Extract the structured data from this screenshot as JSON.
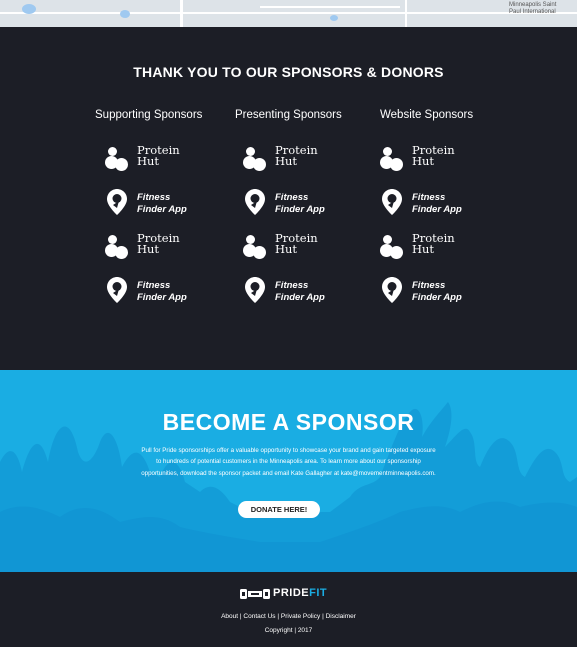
{
  "map": {
    "city_label": "Minneapolis Saint Paul International"
  },
  "sponsors": {
    "title": "THANK YOU TO OUR SPONSORS & DONORS",
    "columns": [
      {
        "heading": "Supporting Sponsors",
        "logos": [
          {
            "type": "protein-hut",
            "line1": "Protein",
            "line2": "Hut"
          },
          {
            "type": "fitness-finder",
            "line1": "Fitness",
            "line2": "Finder App"
          },
          {
            "type": "protein-hut",
            "line1": "Protein",
            "line2": "Hut"
          },
          {
            "type": "fitness-finder",
            "line1": "Fitness",
            "line2": "Finder App"
          }
        ]
      },
      {
        "heading": "Presenting Sponsors",
        "logos": [
          {
            "type": "protein-hut",
            "line1": "Protein",
            "line2": "Hut"
          },
          {
            "type": "fitness-finder",
            "line1": "Fitness",
            "line2": "Finder App"
          },
          {
            "type": "protein-hut",
            "line1": "Protein",
            "line2": "Hut"
          },
          {
            "type": "fitness-finder",
            "line1": "Fitness",
            "line2": "Finder App"
          }
        ]
      },
      {
        "heading": "Website Sponsors",
        "logos": [
          {
            "type": "protein-hut",
            "line1": "Protein",
            "line2": "Hut"
          },
          {
            "type": "fitness-finder",
            "line1": "Fitness",
            "line2": "Finder App"
          },
          {
            "type": "protein-hut",
            "line1": "Protein",
            "line2": "Hut"
          },
          {
            "type": "fitness-finder",
            "line1": "Fitness",
            "line2": "Finder App"
          }
        ]
      }
    ]
  },
  "become": {
    "title": "BECOME A SPONSOR",
    "text": "Pull for Pride sponsorships offer a valuable opportunity to showcase your brand and gain targeted exposure to hundreds of potential customers in the Minneapolis area. To learn more about our sponsorship opportunities, download the sponsor packet and email Kate Gallagher at kate@movementminneapolis.com.",
    "button_label": "DONATE HERE!"
  },
  "footer": {
    "brand_part1": "PRIDE",
    "brand_part2": "FIT",
    "links": [
      "About",
      "Contact Us",
      "Private Policy",
      "Disclaimer"
    ],
    "copyright": "Copyright | 2017"
  },
  "colors": {
    "dark_bg": "#1c1e26",
    "accent_blue": "#1aade3",
    "crowd_blue": "#0f8fd0"
  }
}
